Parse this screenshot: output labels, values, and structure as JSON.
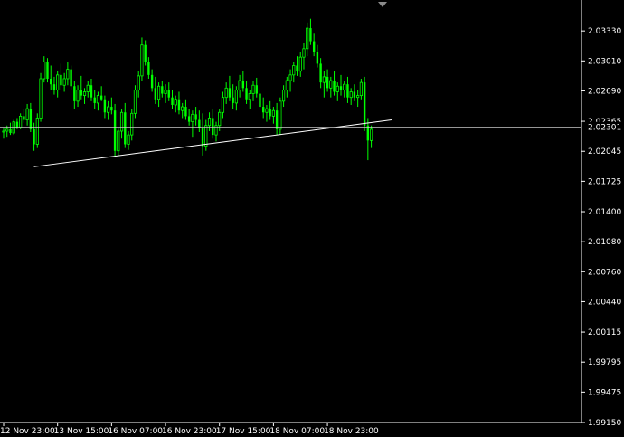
{
  "chart_data": {
    "type": "candlestick",
    "title": "",
    "xlabel": "",
    "ylabel": "",
    "ylim": [
      1.9915,
      2.0366
    ],
    "y_ticks": [
      "2.03330",
      "2.03010",
      "2.02690",
      "2.02365",
      "2.02045",
      "2.01725",
      "2.01400",
      "2.01080",
      "2.00760",
      "2.00440",
      "2.00115",
      "1.99795",
      "1.99475",
      "1.99150"
    ],
    "x_tick_labels": [
      "12 Nov 23:00",
      "13 Nov 15:00",
      "16 Nov 07:00",
      "16 Nov 23:00",
      "17 Nov 15:00",
      "18 Nov 07:00",
      "18 Nov 23:00"
    ],
    "x_tick_bar_index": [
      0,
      16,
      32,
      48,
      64,
      80,
      96
    ],
    "current_price": "2.02301",
    "current_price_value": 2.02301,
    "trendline": {
      "from_bar": 9,
      "from_price": 2.0188,
      "to_bar": 115,
      "to_price": 2.0238
    },
    "grid": false,
    "colors": {
      "background": "#000000",
      "candle": "#00ff00",
      "axis": "#ffffff",
      "text": "#ffffff",
      "trendline": "#ffffff",
      "price_line": "#c8c8c8",
      "marker": "#8a8a8a"
    },
    "candles": [
      [
        2.0225,
        2.023,
        2.0218,
        2.0226
      ],
      [
        2.0226,
        2.0232,
        2.022,
        2.0228
      ],
      [
        2.0228,
        2.0235,
        2.0222,
        2.0224
      ],
      [
        2.0224,
        2.0238,
        2.0222,
        2.0236
      ],
      [
        2.0236,
        2.024,
        2.0228,
        2.023
      ],
      [
        2.023,
        2.0245,
        2.0228,
        2.0242
      ],
      [
        2.0242,
        2.025,
        2.0235,
        2.0238
      ],
      [
        2.0238,
        2.0255,
        2.0232,
        2.025
      ],
      [
        2.025,
        2.0256,
        2.0225,
        2.0228
      ],
      [
        2.0228,
        2.0235,
        2.0205,
        2.0212
      ],
      [
        2.0212,
        2.0245,
        2.0208,
        2.024
      ],
      [
        2.024,
        2.0288,
        2.0236,
        2.0282
      ],
      [
        2.0282,
        2.0306,
        2.0278,
        2.03
      ],
      [
        2.03,
        2.0304,
        2.0278,
        2.0282
      ],
      [
        2.0282,
        2.0296,
        2.027,
        2.0276
      ],
      [
        2.0276,
        2.0284,
        2.0265,
        2.027
      ],
      [
        2.027,
        2.029,
        2.0262,
        2.0286
      ],
      [
        2.0286,
        2.0298,
        2.027,
        2.0275
      ],
      [
        2.0275,
        2.0288,
        2.0268,
        2.0282
      ],
      [
        2.0282,
        2.03,
        2.0275,
        2.0292
      ],
      [
        2.0292,
        2.0296,
        2.027,
        2.0274
      ],
      [
        2.0274,
        2.028,
        2.025,
        2.0258
      ],
      [
        2.0258,
        2.0275,
        2.0252,
        2.027
      ],
      [
        2.027,
        2.0285,
        2.026,
        2.0264
      ],
      [
        2.0264,
        2.0272,
        2.0255,
        2.0268
      ],
      [
        2.0268,
        2.028,
        2.0262,
        2.0275
      ],
      [
        2.0275,
        2.0282,
        2.0258,
        2.0262
      ],
      [
        2.0262,
        2.027,
        2.025,
        2.0256
      ],
      [
        2.0256,
        2.0268,
        2.0248,
        2.0264
      ],
      [
        2.0264,
        2.0274,
        2.0258,
        2.026
      ],
      [
        2.026,
        2.0264,
        2.024,
        2.0246
      ],
      [
        2.0246,
        2.0258,
        2.0238,
        2.0252
      ],
      [
        2.0252,
        2.0262,
        2.0244,
        2.0248
      ],
      [
        2.0248,
        2.0255,
        2.0198,
        2.0205
      ],
      [
        2.0205,
        2.023,
        2.02,
        2.0226
      ],
      [
        2.0226,
        2.025,
        2.0218,
        2.0246
      ],
      [
        2.0246,
        2.0256,
        2.0208,
        2.0212
      ],
      [
        2.0212,
        2.0226,
        2.0206,
        2.0222
      ],
      [
        2.0222,
        2.025,
        2.0216,
        2.0245
      ],
      [
        2.0245,
        2.0275,
        2.024,
        2.027
      ],
      [
        2.027,
        2.029,
        2.0262,
        2.0285
      ],
      [
        2.0285,
        2.0326,
        2.028,
        2.0318
      ],
      [
        2.0318,
        2.0323,
        2.0296,
        2.03
      ],
      [
        2.03,
        2.0305,
        2.0282,
        2.0286
      ],
      [
        2.0286,
        2.0292,
        2.0268,
        2.0272
      ],
      [
        2.0272,
        2.0284,
        2.0255,
        2.026
      ],
      [
        2.026,
        2.0278,
        2.0252,
        2.0274
      ],
      [
        2.0274,
        2.028,
        2.0262,
        2.0266
      ],
      [
        2.0266,
        2.0276,
        2.0256,
        2.027
      ],
      [
        2.027,
        2.0278,
        2.0258,
        2.0262
      ],
      [
        2.0262,
        2.027,
        2.025,
        2.0254
      ],
      [
        2.0254,
        2.0264,
        2.0246,
        2.026
      ],
      [
        2.026,
        2.0268,
        2.0244,
        2.0248
      ],
      [
        2.0248,
        2.0256,
        2.024,
        2.0252
      ],
      [
        2.0252,
        2.026,
        2.0238,
        2.0242
      ],
      [
        2.0242,
        2.025,
        2.0232,
        2.0236
      ],
      [
        2.0236,
        2.0248,
        2.022,
        2.0244
      ],
      [
        2.0244,
        2.0252,
        2.0232,
        2.0238
      ],
      [
        2.0238,
        2.0248,
        2.0225,
        2.023
      ],
      [
        2.023,
        2.0245,
        2.02,
        2.021
      ],
      [
        2.021,
        2.0238,
        2.0205,
        2.0232
      ],
      [
        2.0232,
        2.0246,
        2.0226,
        2.024
      ],
      [
        2.024,
        2.025,
        2.0218,
        2.0222
      ],
      [
        2.0222,
        2.0236,
        2.0215,
        2.0232
      ],
      [
        2.0232,
        2.025,
        2.0226,
        2.0246
      ],
      [
        2.0246,
        2.0268,
        2.024,
        2.0262
      ],
      [
        2.0262,
        2.0278,
        2.0255,
        2.0272
      ],
      [
        2.0272,
        2.0285,
        2.0258,
        2.0262
      ],
      [
        2.0262,
        2.0276,
        2.025,
        2.0256
      ],
      [
        2.0256,
        2.0274,
        2.0248,
        2.027
      ],
      [
        2.027,
        2.0286,
        2.0262,
        2.028
      ],
      [
        2.028,
        2.029,
        2.0268,
        2.0272
      ],
      [
        2.0272,
        2.028,
        2.0255,
        2.026
      ],
      [
        2.026,
        2.027,
        2.025,
        2.0266
      ],
      [
        2.0266,
        2.028,
        2.0258,
        2.0275
      ],
      [
        2.0275,
        2.0283,
        2.0262,
        2.0266
      ],
      [
        2.0266,
        2.0272,
        2.0248,
        2.0252
      ],
      [
        2.0252,
        2.0262,
        2.024,
        2.0246
      ],
      [
        2.0246,
        2.0254,
        2.0236,
        2.025
      ],
      [
        2.025,
        2.0258,
        2.0238,
        2.0242
      ],
      [
        2.0242,
        2.0252,
        2.0234,
        2.0248
      ],
      [
        2.0248,
        2.0256,
        2.0222,
        2.0228
      ],
      [
        2.0228,
        2.0262,
        2.0222,
        2.0258
      ],
      [
        2.0258,
        2.0275,
        2.0252,
        2.027
      ],
      [
        2.027,
        2.0284,
        2.0262,
        2.028
      ],
      [
        2.028,
        2.0292,
        2.0268,
        2.0286
      ],
      [
        2.0286,
        2.03,
        2.0278,
        2.0296
      ],
      [
        2.0296,
        2.0306,
        2.0285,
        2.029
      ],
      [
        2.029,
        2.031,
        2.0284,
        2.0305
      ],
      [
        2.0305,
        2.032,
        2.0292,
        2.0314
      ],
      [
        2.0314,
        2.0342,
        2.0306,
        2.0336
      ],
      [
        2.0336,
        2.0346,
        2.0318,
        2.0322
      ],
      [
        2.0322,
        2.033,
        2.0306,
        2.031
      ],
      [
        2.031,
        2.0318,
        2.0294,
        2.0298
      ],
      [
        2.0298,
        2.0304,
        2.0272,
        2.0278
      ],
      [
        2.0278,
        2.029,
        2.0262,
        2.0284
      ],
      [
        2.0284,
        2.0292,
        2.0268,
        2.0272
      ],
      [
        2.0272,
        2.0284,
        2.0262,
        2.028
      ],
      [
        2.028,
        2.029,
        2.0264,
        2.0268
      ],
      [
        2.0268,
        2.0278,
        2.0258,
        2.0274
      ],
      [
        2.0274,
        2.0286,
        2.0264,
        2.027
      ],
      [
        2.027,
        2.028,
        2.0262,
        2.0276
      ],
      [
        2.0276,
        2.0284,
        2.0256,
        2.0262
      ],
      [
        2.0262,
        2.0272,
        2.0254,
        2.0268
      ],
      [
        2.0268,
        2.0276,
        2.0258,
        2.0262
      ],
      [
        2.0262,
        2.027,
        2.0252,
        2.0264
      ],
      [
        2.0264,
        2.0282,
        2.026,
        2.0278
      ],
      [
        2.0278,
        2.0284,
        2.0226,
        2.0232
      ],
      [
        2.0232,
        2.024,
        2.0195,
        2.0216
      ],
      [
        2.0216,
        2.0232,
        2.0208,
        2.0228
      ]
    ]
  }
}
